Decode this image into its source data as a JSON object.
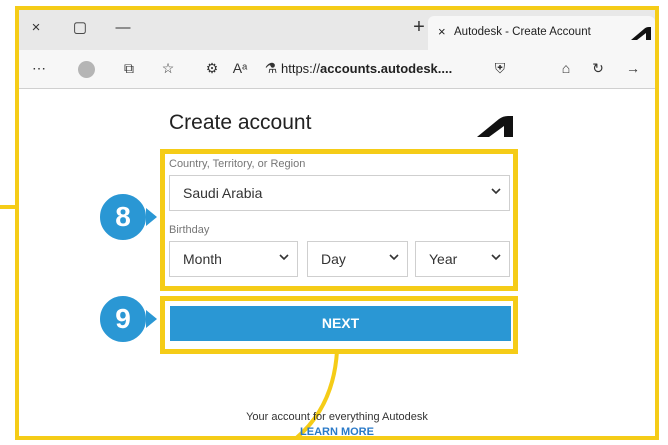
{
  "browser": {
    "tab_close_glyph": "×",
    "tab_title": "Autodesk - Create Account",
    "new_tab_glyph": "+",
    "window_close_glyph": "×",
    "window_maximize_glyph": "▢",
    "window_minimize_glyph": "—",
    "url_prefix": "https://",
    "url_host": "accounts.autodesk....",
    "toolbar_glyphs": {
      "more": "⋯",
      "collections": "⧉",
      "favorites": "☆",
      "extensions": "⚙",
      "read_aloud": "Aᵃ",
      "url_icon": "⚗",
      "site_info": "⛨",
      "home": "⌂",
      "refresh": "↻",
      "forward": "→"
    }
  },
  "form": {
    "title": "Create account",
    "country_label": "Country, Territory, or Region",
    "country_value": "Saudi Arabia",
    "birthday_label": "Birthday",
    "month_value": "Month",
    "day_value": "Day",
    "year_value": "Year",
    "next_label": "NEXT"
  },
  "footer": {
    "text": "Your account for everything Autodesk",
    "link": "LEARN MORE"
  },
  "callouts": {
    "step8": "8",
    "step9": "9"
  },
  "colors": {
    "highlight": "#f5cc17",
    "accent": "#2a97d4"
  }
}
